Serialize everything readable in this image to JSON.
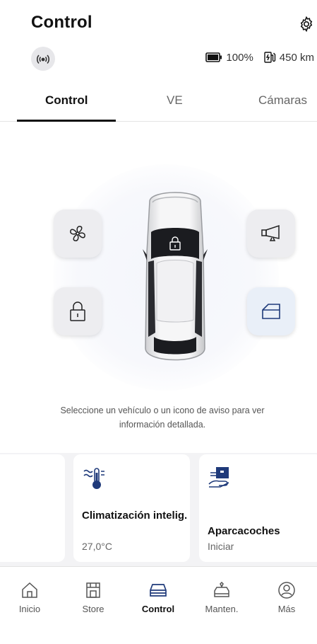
{
  "header": {
    "title": "Control",
    "battery_percent": "100%",
    "range": "450 km"
  },
  "tabs": [
    {
      "label": "Control",
      "active": true
    },
    {
      "label": "VE",
      "active": false
    },
    {
      "label": "Cámaras",
      "active": false
    }
  ],
  "vehicle_controls": [
    {
      "icon": "fan-icon"
    },
    {
      "icon": "horn-icon"
    },
    {
      "icon": "lock-icon"
    },
    {
      "icon": "door-icon"
    }
  ],
  "hint_text": "Seleccione un vehículo o un icono de aviso para ver información detallada.",
  "cards": [
    {
      "icon": "climate-icon",
      "title": "Climatización intelig.",
      "subtitle": "27,0°C"
    },
    {
      "icon": "valet-icon",
      "title": "Aparcacoches",
      "subtitle": "Iniciar"
    }
  ],
  "bottom_nav": [
    {
      "label": "Inicio",
      "icon": "home-icon",
      "active": false
    },
    {
      "label": "Store",
      "icon": "store-icon",
      "active": false
    },
    {
      "label": "Control",
      "icon": "car-icon",
      "active": true
    },
    {
      "label": "Manten.",
      "icon": "maintenance-icon",
      "active": false
    },
    {
      "label": "Más",
      "icon": "profile-icon",
      "active": false
    }
  ],
  "colors": {
    "accent_blue": "#1f3a7a",
    "panel_gray": "#ededf0",
    "background": "#ffffff"
  }
}
